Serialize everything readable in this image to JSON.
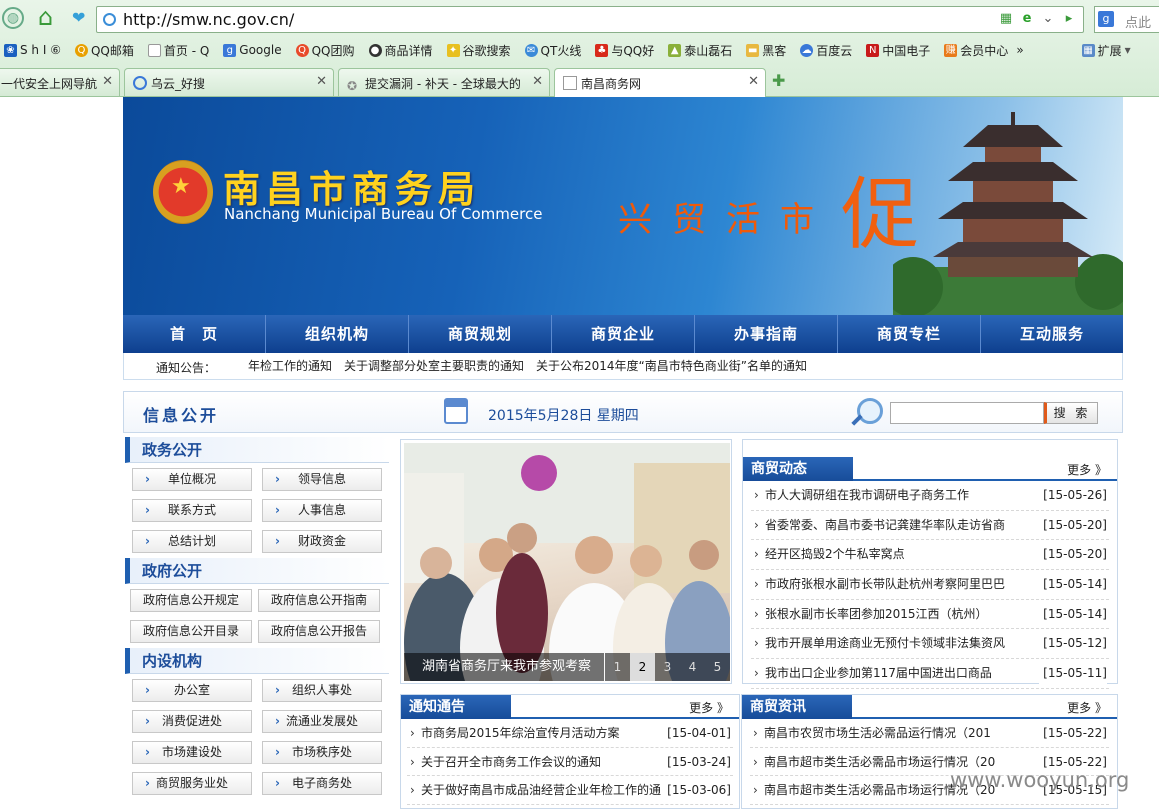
{
  "browser": {
    "url": "http://smw.nc.gov.cn/",
    "search_placeholder": "点此",
    "favorites": [
      "S h I ⑥",
      "QQ邮箱",
      "首页 - Q",
      "Google",
      "QQ团购",
      "商品详情",
      "谷歌搜索",
      "QT火线",
      "与QQ好",
      "泰山磊石",
      "黑客",
      "百度云",
      "中国电子",
      "会员中心"
    ],
    "more": "»",
    "extensions": "扩展",
    "tabs": [
      {
        "label": "一代安全上网导航"
      },
      {
        "label": "乌云_好搜"
      },
      {
        "label": "提交漏洞 - 补天 - 全球最大的"
      },
      {
        "label": "南昌商务网"
      }
    ]
  },
  "site": {
    "title": "南昌市商务局",
    "subtitle": "Nanchang Municipal Bureau Of Commerce",
    "slogan": "兴贸活市",
    "slogan_big": "促",
    "nav": [
      "首　页",
      "组织机构",
      "商贸规划",
      "商贸企业",
      "办事指南",
      "商贸专栏",
      "互动服务"
    ],
    "notice_label": "通知公告：",
    "notice_text": "年检工作的通知　关于调整部分处室主要职责的通知　关于公布2014年度“南昌市特色商业街”名单的通知",
    "info_title": "信息公开",
    "date": "2015年5月28日 星期四",
    "search_button": "搜 索"
  },
  "left": {
    "gov_affairs": {
      "title": "政务公开",
      "items": [
        "单位概况",
        "领导信息",
        "联系方式",
        "人事信息",
        "总结计划",
        "财政资金"
      ]
    },
    "gov_info": {
      "title": "政府公开",
      "items": [
        "政府信息公开规定",
        "政府信息公开指南",
        "政府信息公开目录",
        "政府信息公开报告"
      ]
    },
    "depts": {
      "title": "内设机构",
      "items": [
        "办公室",
        "组织人事处",
        "消费促进处",
        "流通业发展处",
        "市场建设处",
        "市场秩序处",
        "商贸服务业处",
        "电子商务处"
      ]
    }
  },
  "photo": {
    "caption": "湖南省商务厅来我市参观考察",
    "pages": [
      "1",
      "2",
      "3",
      "4",
      "5"
    ],
    "active": 1
  },
  "news": {
    "title": "商贸动态",
    "more": "更多 》",
    "items": [
      {
        "t": "市人大调研组在我市调研电子商务工作",
        "d": "[15-05-26]"
      },
      {
        "t": "省委常委、南昌市委书记龚建华率队走访省商",
        "d": "[15-05-20]"
      },
      {
        "t": "经开区捣毁2个牛私宰窝点",
        "d": "[15-05-20]"
      },
      {
        "t": "市政府张根水副市长带队赴杭州考察阿里巴巴",
        "d": "[15-05-14]"
      },
      {
        "t": "张根水副市长率团参加2015江西（杭州）",
        "d": "[15-05-14]"
      },
      {
        "t": "我市开展单用途商业无预付卡领域非法集资风",
        "d": "[15-05-12]"
      },
      {
        "t": "我市出口企业参加第117届中国进出口商品",
        "d": "[15-05-11]"
      }
    ]
  },
  "notices": {
    "title": "通知通告",
    "more": "更多 》",
    "items": [
      {
        "t": "市商务局2015年综治宣传月活动方案",
        "d": "[15-04-01]"
      },
      {
        "t": "关于召开全市商务工作会议的通知",
        "d": "[15-03-24]"
      },
      {
        "t": "关于做好南昌市成品油经营企业年检工作的通",
        "d": "[15-03-06]"
      }
    ]
  },
  "info": {
    "title": "商贸资讯",
    "more": "更多 》",
    "items": [
      {
        "t": "南昌市农贸市场生活必需品运行情况（201",
        "d": "[15-05-22]"
      },
      {
        "t": "南昌市超市类生活必需品市场运行情况（20",
        "d": "[15-05-22]"
      },
      {
        "t": "南昌市超市类生活必需品市场运行情况（20",
        "d": "[15-05-15]"
      }
    ]
  },
  "watermark": "www.wooyun.org"
}
